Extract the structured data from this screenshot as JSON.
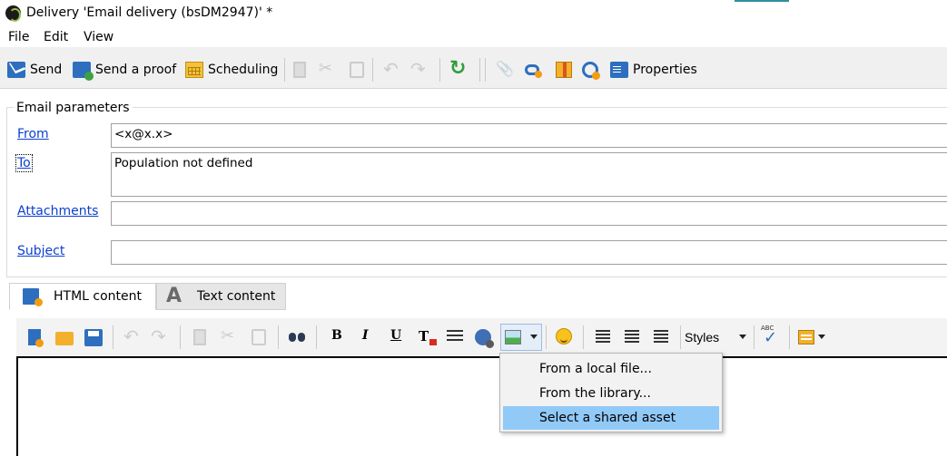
{
  "window": {
    "title": "Delivery 'Email delivery (bsDM2947)' *"
  },
  "menu": {
    "file": "File",
    "edit": "Edit",
    "view": "View"
  },
  "toolbar": {
    "send": "Send",
    "send_proof": "Send a proof",
    "scheduling": "Scheduling",
    "properties": "Properties"
  },
  "email_params": {
    "title": "Email parameters",
    "from_label": "From",
    "from_value": "<x@x.x>",
    "to_label": "To",
    "to_value": "Population not defined",
    "attachments_label": "Attachments",
    "attachments_value": "",
    "subject_label": "Subject",
    "subject_value": ""
  },
  "tabs": {
    "html": "HTML content",
    "text": "Text content"
  },
  "editor_toolbar": {
    "bold": "B",
    "italic": "I",
    "underline": "U",
    "styles": "Styles"
  },
  "image_menu": {
    "items": [
      "From a local file...",
      "From the library...",
      "Select a shared asset"
    ],
    "selected_index": 2
  },
  "colors": {
    "link": "#0b3fd1",
    "selected": "#91c9f7"
  }
}
